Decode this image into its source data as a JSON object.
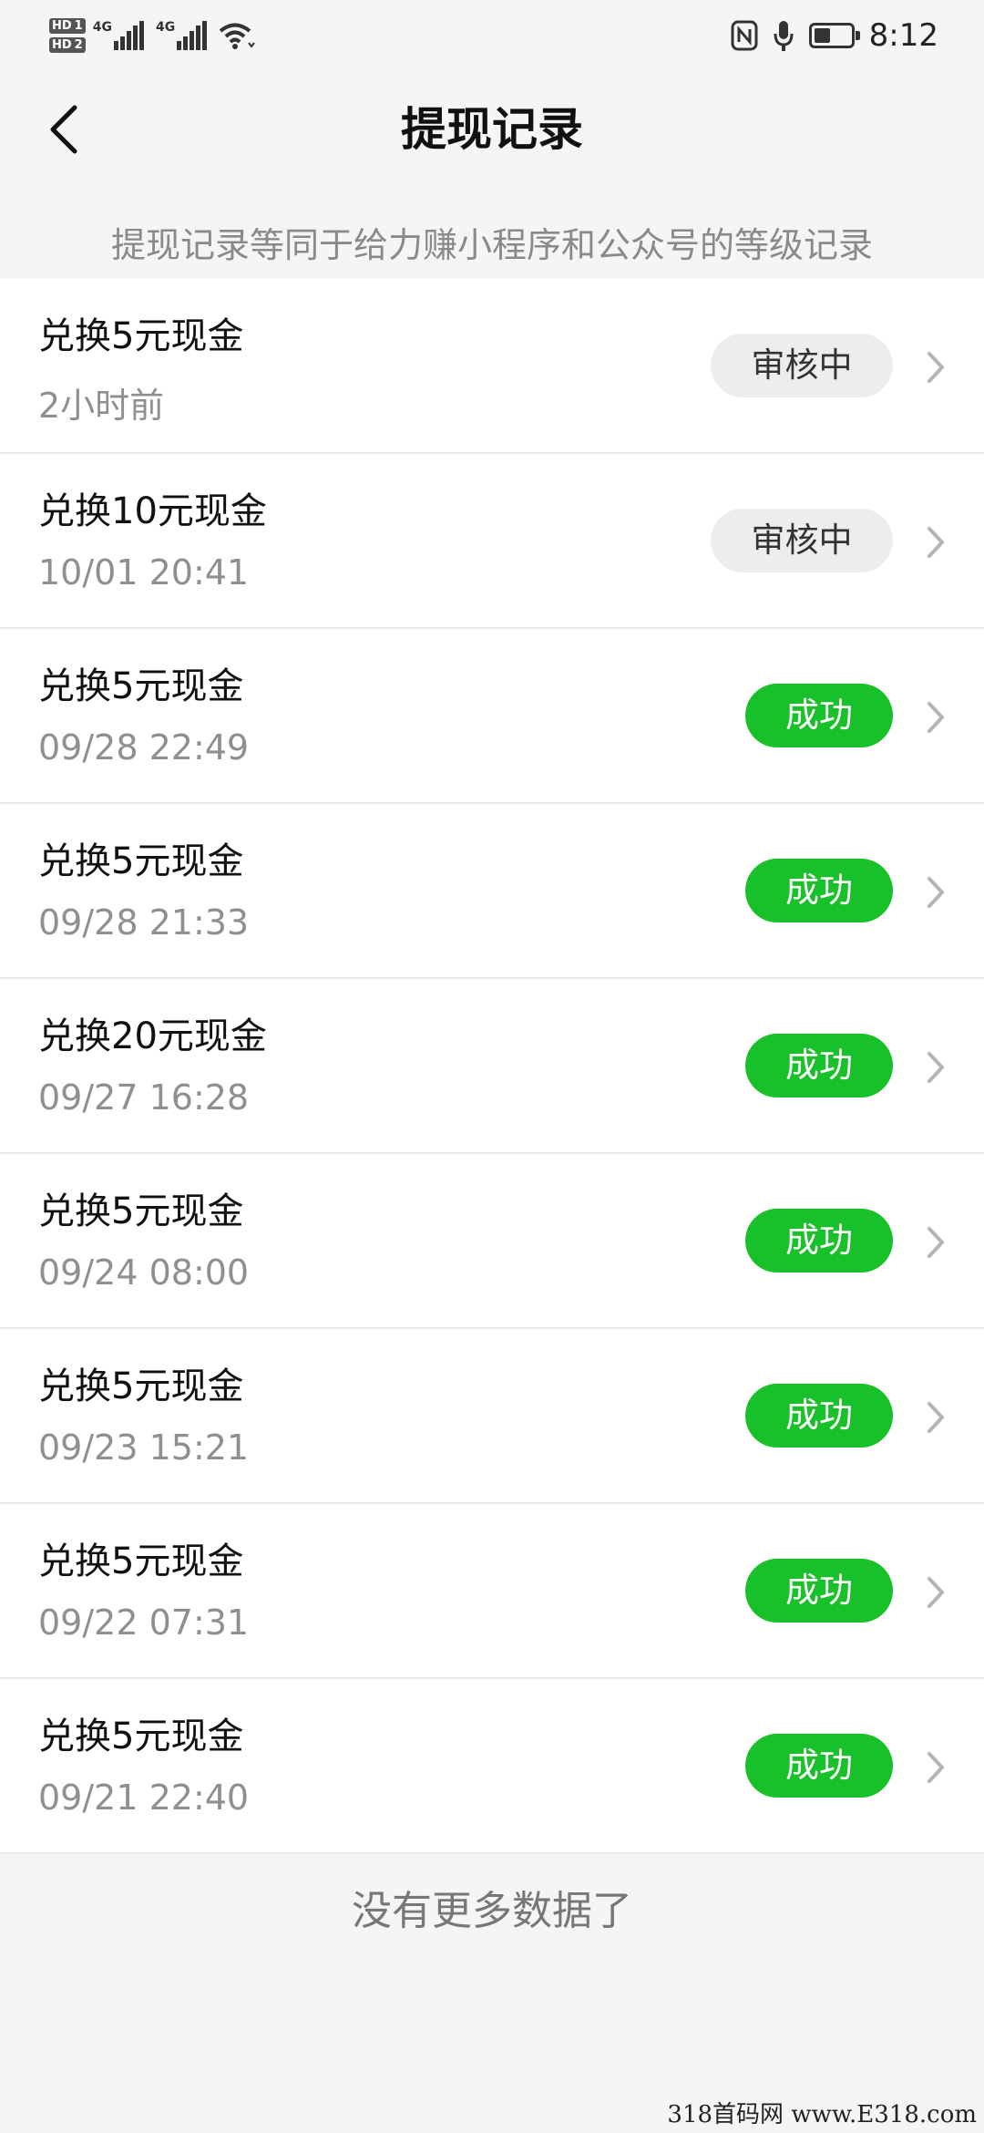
{
  "status_bar": {
    "hd1": "HD",
    "sim1": "1",
    "hd2": "HD",
    "sim2": "2",
    "net1": "4G",
    "net2": "4G",
    "time": "8:12",
    "battery_level": 0.45
  },
  "header": {
    "title": "提现记录",
    "back_icon": "chevron-left-icon"
  },
  "notice": "提现记录等同于给力赚小程序和公众号的等级记录",
  "records": [
    {
      "name": "兑换5元现金",
      "time": "2小时前",
      "status": "审核中",
      "status_type": "pending"
    },
    {
      "name": "兑换10元现金",
      "time": "10/01 20:41",
      "status": "审核中",
      "status_type": "pending"
    },
    {
      "name": "兑换5元现金",
      "time": "09/28 22:49",
      "status": "成功",
      "status_type": "success"
    },
    {
      "name": "兑换5元现金",
      "time": "09/28 21:33",
      "status": "成功",
      "status_type": "success"
    },
    {
      "name": "兑换20元现金",
      "time": "09/27 16:28",
      "status": "成功",
      "status_type": "success"
    },
    {
      "name": "兑换5元现金",
      "time": "09/24 08:00",
      "status": "成功",
      "status_type": "success"
    },
    {
      "name": "兑换5元现金",
      "time": "09/23 15:21",
      "status": "成功",
      "status_type": "success"
    },
    {
      "name": "兑换5元现金",
      "time": "09/22 07:31",
      "status": "成功",
      "status_type": "success"
    },
    {
      "name": "兑换5元现金",
      "time": "09/21 22:40",
      "status": "成功",
      "status_type": "success"
    }
  ],
  "footer": "没有更多数据了",
  "watermark": "318首码网 www.E318.com",
  "colors": {
    "success": "#18c02a",
    "pending_bg": "#ededed",
    "background": "#f5f5f5"
  }
}
